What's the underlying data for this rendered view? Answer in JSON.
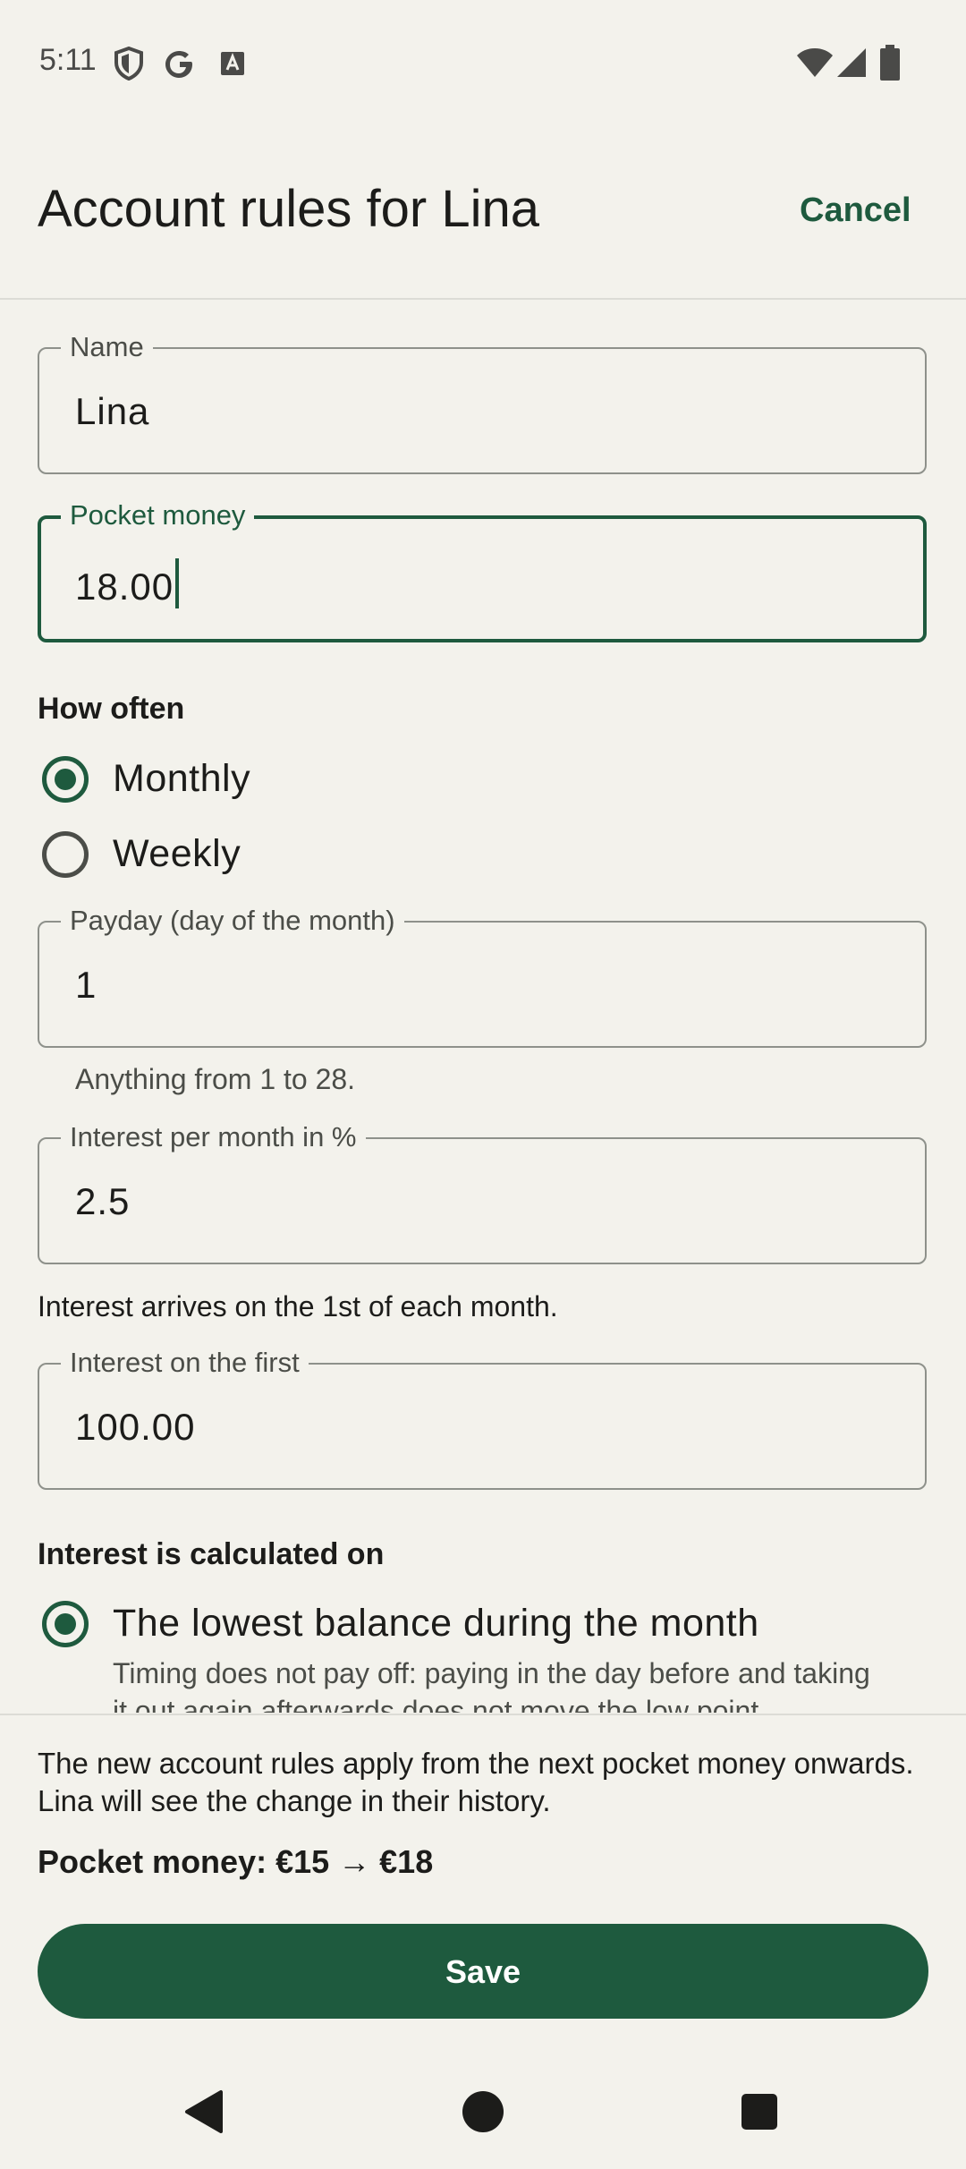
{
  "status_bar": {
    "time": "5:11",
    "left_icons": [
      "shield-icon",
      "google-icon",
      "font-icon"
    ],
    "right_icons": [
      "wifi-icon",
      "signal-icon",
      "battery-icon"
    ]
  },
  "header": {
    "title": "Account rules for Lina",
    "cancel_label": "Cancel"
  },
  "form": {
    "name": {
      "label": "Name",
      "value": "Lina"
    },
    "pocket_money": {
      "label": "Pocket money",
      "value": "18.00"
    },
    "frequency": {
      "title": "How often",
      "options": [
        {
          "label": "Monthly",
          "selected": true
        },
        {
          "label": "Weekly",
          "selected": false
        }
      ]
    },
    "payday": {
      "label": "Payday (day of the month)",
      "value": "1",
      "helper": "Anything from 1 to 28."
    },
    "interest": {
      "label": "Interest per month in %",
      "value": "2.5",
      "note": "Interest arrives on the 1st of each month."
    },
    "interest_on_first": {
      "label": "Interest on the first",
      "value": "100.00"
    },
    "calculation": {
      "title": "Interest is calculated on",
      "option_label": "The lowest balance during the month",
      "option_selected": true,
      "option_desc_line1": "Timing does not pay off: paying in the day before and taking",
      "option_desc_line2": "it out again afterwards does not move the low point."
    }
  },
  "footer": {
    "info_line1": "The new account rules apply from the next pocket money onwards.",
    "info_line2": "Lina will see the change in their history.",
    "change_summary": "Pocket money: €15 → €18",
    "save_label": "Save"
  },
  "colors": {
    "accent": "#1e5a3e",
    "background": "#f3f2ec",
    "text": "#1c1c1a"
  }
}
